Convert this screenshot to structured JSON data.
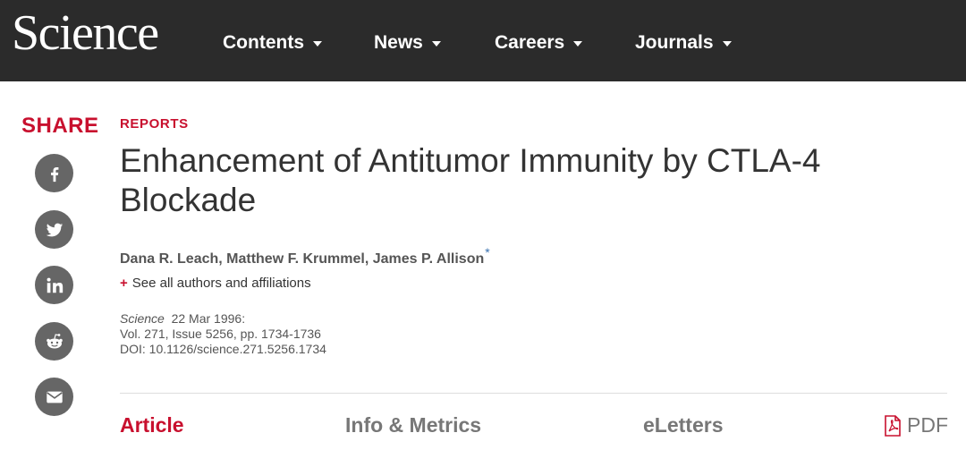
{
  "header": {
    "logo": "Science",
    "nav": [
      {
        "label": "Contents"
      },
      {
        "label": "News"
      },
      {
        "label": "Careers"
      },
      {
        "label": "Journals"
      }
    ]
  },
  "share": {
    "label": "SHARE",
    "buttons": [
      {
        "icon": "facebook-icon"
      },
      {
        "icon": "twitter-icon"
      },
      {
        "icon": "linkedin-icon"
      },
      {
        "icon": "reddit-icon"
      },
      {
        "icon": "email-icon"
      }
    ]
  },
  "article": {
    "section": "REPORTS",
    "title": "Enhancement of Antitumor Immunity by CTLA-4 Blockade",
    "authors": "Dana R. Leach, Matthew F. Krummel, James P. Allison",
    "author_marker": "*",
    "see_all_plus": "+",
    "see_all": "See all authors and affiliations",
    "journal": "Science",
    "date": "22 Mar 1996:",
    "volume": "Vol. 271, Issue 5256, pp. 1734-1736",
    "doi": "DOI: 10.1126/science.271.5256.1734"
  },
  "tabs": [
    {
      "label": "Article",
      "active": true
    },
    {
      "label": "Info & Metrics",
      "active": false
    },
    {
      "label": "eLetters",
      "active": false
    }
  ],
  "pdf": {
    "label": "PDF",
    "icon": "pdf-icon"
  },
  "colors": {
    "brand_red": "#c8102e",
    "header_bg": "#2b2b2b",
    "icon_gray": "#666666"
  }
}
